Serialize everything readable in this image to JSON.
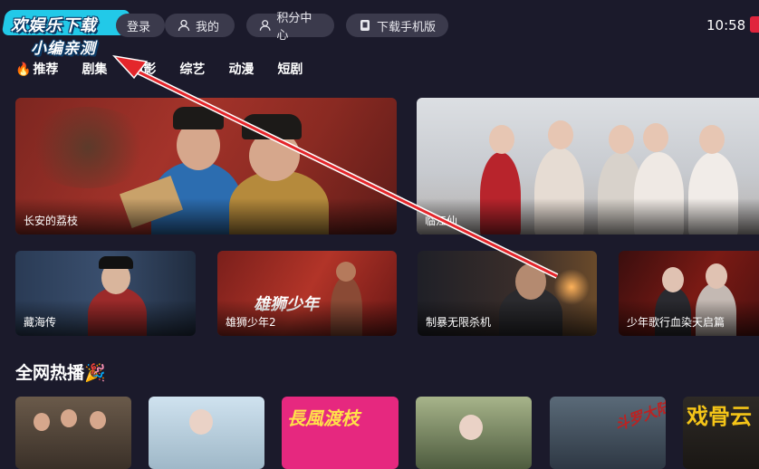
{
  "logo": {
    "line1": "欢娱乐下载",
    "line2": "小编亲测"
  },
  "header": {
    "login_label": "登录",
    "mine_label": "我的",
    "points_label": "积分中心",
    "download_label": "下载手机版",
    "time": "10:58"
  },
  "categories": [
    "推荐",
    "剧集",
    "电影",
    "综艺",
    "动漫",
    "短剧"
  ],
  "banners": [
    {
      "title": "长安的荔枝"
    },
    {
      "title": "临江仙"
    }
  ],
  "row2": [
    {
      "title": "藏海传"
    },
    {
      "title": "雄狮少年2"
    },
    {
      "title": "制暴无限杀机"
    },
    {
      "title": "少年歌行血染天启篇"
    }
  ],
  "section": {
    "title": "全网热播🎉"
  },
  "poster_texts": {
    "p3": "長風渡枝",
    "p5": "斗罗大陆",
    "p6": "戏骨云"
  },
  "icons": [
    "user-icon",
    "user-icon",
    "phone-icon",
    "fire-icon"
  ],
  "colors": {
    "background": "#1b1a2b",
    "pill": "#3b3a4c",
    "logo_cyan": "#22c9e8",
    "arrow_red": "#e4262b"
  }
}
